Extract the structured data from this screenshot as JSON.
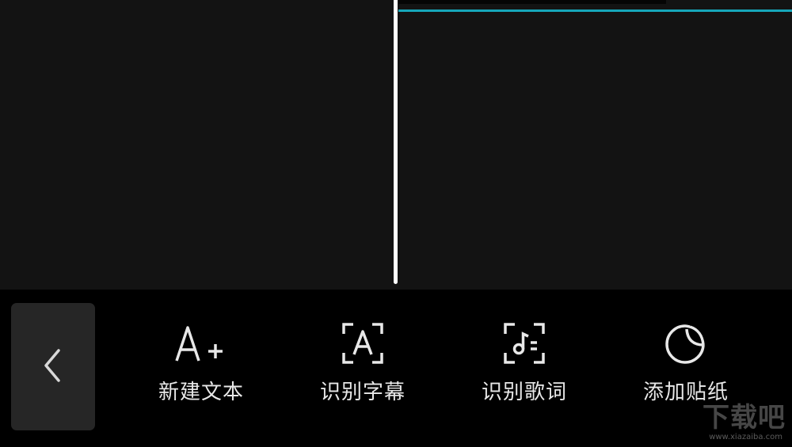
{
  "toolbar": {
    "tools": [
      {
        "label": "新建文本",
        "icon": "text-add-icon"
      },
      {
        "label": "识别字幕",
        "icon": "recognize-subtitle-icon"
      },
      {
        "label": "识别歌词",
        "icon": "recognize-lyrics-icon"
      },
      {
        "label": "添加贴纸",
        "icon": "sticker-icon"
      }
    ]
  },
  "watermark": {
    "text": "下载吧",
    "url": "www.xiazaiba.com"
  },
  "colors": {
    "track_accent": "#16a6ba",
    "background": "#131313",
    "toolbar_background": "#000000",
    "back_button_background": "#262626"
  }
}
